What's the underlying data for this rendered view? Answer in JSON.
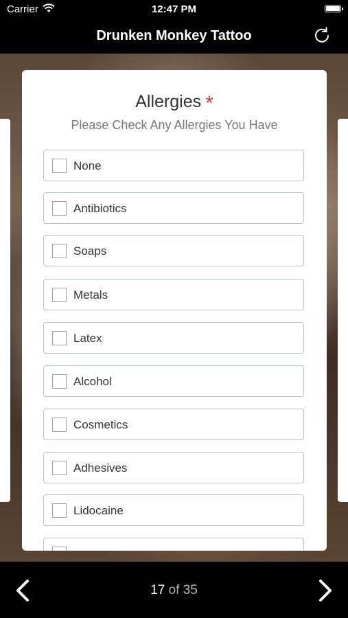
{
  "status": {
    "carrier": "Carrier",
    "time": "12:47 PM"
  },
  "nav": {
    "title": "Drunken Monkey Tattoo",
    "refresh_icon": "refresh-icon"
  },
  "card": {
    "title": "Allergies",
    "required_mark": "*",
    "subtitle": "Please Check Any Allergies You Have",
    "options": [
      {
        "label": "None",
        "checked": false
      },
      {
        "label": "Antibiotics",
        "checked": false
      },
      {
        "label": "Soaps",
        "checked": false
      },
      {
        "label": "Metals",
        "checked": false
      },
      {
        "label": "Latex",
        "checked": false
      },
      {
        "label": "Alcohol",
        "checked": false
      },
      {
        "label": "Cosmetics",
        "checked": false
      },
      {
        "label": "Adhesives",
        "checked": false
      },
      {
        "label": "Lidocaine",
        "checked": false
      }
    ]
  },
  "pager": {
    "current": "17",
    "of_label": "of",
    "total": "35"
  },
  "colors": {
    "accent_required": "#e53935",
    "bar_background": "#000000"
  }
}
